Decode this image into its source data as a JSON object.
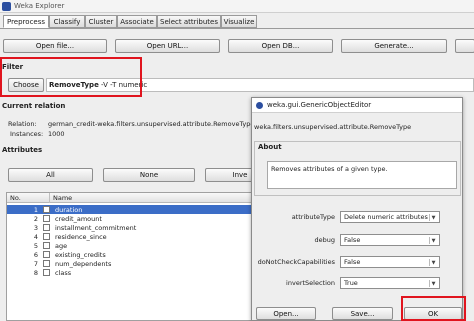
{
  "window": {
    "title": "Weka Explorer"
  },
  "tabs": [
    "Preprocess",
    "Classify",
    "Cluster",
    "Associate",
    "Select attributes",
    "Visualize"
  ],
  "toolbar": {
    "open_file": "Open file...",
    "open_url": "Open URL...",
    "open_db": "Open DB...",
    "generate": "Generate..."
  },
  "filter": {
    "title": "Filter",
    "choose": "Choose",
    "name": "RemoveType",
    "options": " -V -T numeric"
  },
  "relation": {
    "title": "Current relation",
    "relation_label": "Relation:",
    "relation_value": "german_credit-weka.filters.unsupervised.attribute.RemoveType",
    "instances_label": "Instances:",
    "instances_value": "1000"
  },
  "attributes": {
    "title": "Attributes",
    "all": "All",
    "none": "None",
    "invert": "Inve",
    "col_no": "No.",
    "col_name": "Name",
    "rows": [
      {
        "no": "1",
        "name": "duration"
      },
      {
        "no": "2",
        "name": "credit_amount"
      },
      {
        "no": "3",
        "name": "installment_commitment"
      },
      {
        "no": "4",
        "name": "residence_since"
      },
      {
        "no": "5",
        "name": "age"
      },
      {
        "no": "6",
        "name": "existing_credits"
      },
      {
        "no": "7",
        "name": "num_dependents"
      },
      {
        "no": "8",
        "name": "class"
      }
    ]
  },
  "dialog": {
    "title": "weka.gui.GenericObjectEditor",
    "classname": "weka.filters.unsupervised.attribute.RemoveType",
    "about_title": "About",
    "about_text": "Removes attributes of a given type.",
    "props": [
      {
        "label": "attributeType",
        "value": "Delete numeric attributes"
      },
      {
        "label": "debug",
        "value": "False"
      },
      {
        "label": "doNotCheckCapabilities",
        "value": "False"
      },
      {
        "label": "invertSelection",
        "value": "True"
      }
    ],
    "open": "Open...",
    "save": "Save...",
    "ok": "OK"
  },
  "colors": {
    "highlight": "#e0141e",
    "selection": "#3b6dc7"
  }
}
